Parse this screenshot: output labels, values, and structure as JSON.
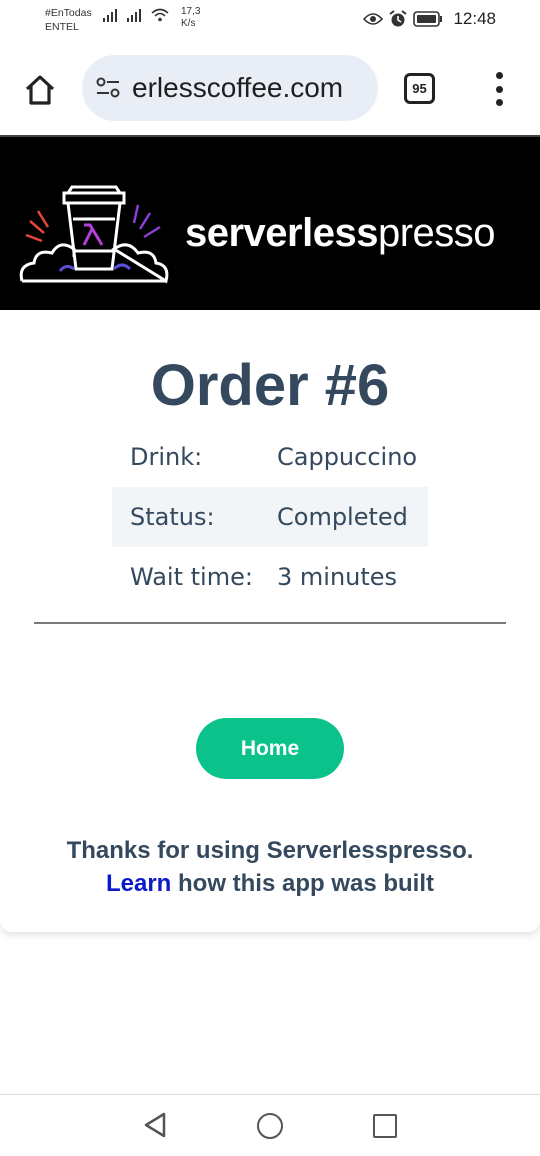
{
  "status_bar": {
    "carrier_line1": "#EnTodas",
    "carrier_line2": "ENTEL",
    "net_speed_value": "17,3",
    "net_speed_unit": "K/s",
    "time": "12:48"
  },
  "browser": {
    "url": "erlesscoffee.com",
    "tab_count": "95"
  },
  "banner": {
    "brand_bold": "serverless",
    "brand_light": "presso"
  },
  "order": {
    "title": "Order #6",
    "details": [
      {
        "label": "Drink:",
        "value": "Cappuccino"
      },
      {
        "label": "Status:",
        "value": "Completed"
      },
      {
        "label": "Wait time:",
        "value": "3 minutes"
      }
    ],
    "home_button": "Home",
    "thanks_text": "Thanks for using Serverlesspresso.",
    "learn_link": "Learn",
    "learn_rest": " how this app was built"
  },
  "colors": {
    "accent_green": "#0bc38a",
    "heading": "#35495e",
    "link": "#0b19c9"
  }
}
